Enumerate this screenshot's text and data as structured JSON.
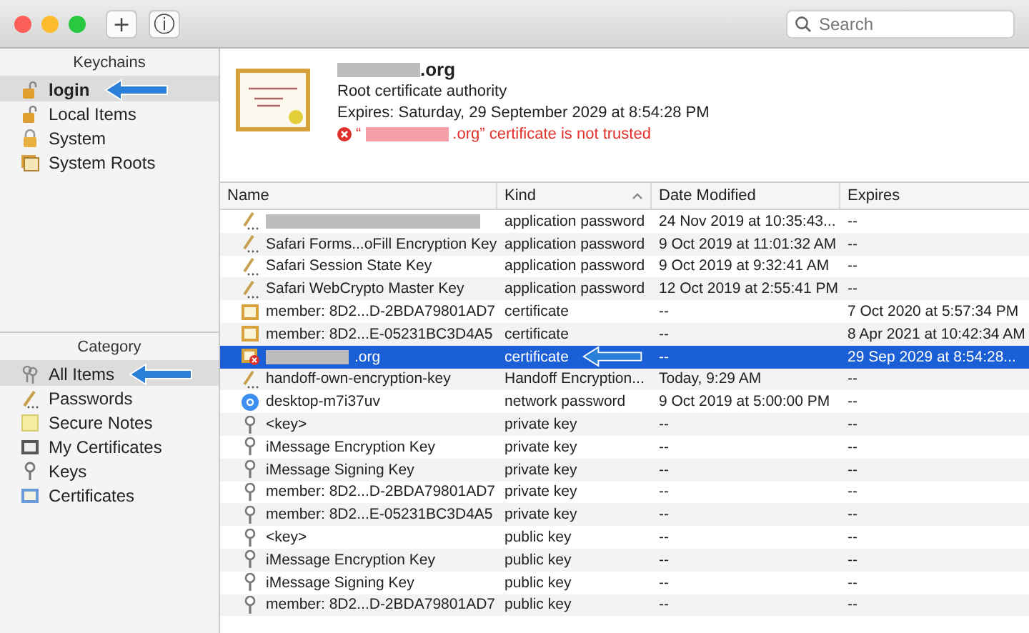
{
  "toolbar": {
    "buttons": [
      "+",
      "ⓘ"
    ],
    "search": {
      "placeholder": "Search"
    }
  },
  "sidebar": {
    "keychains": {
      "title": "Keychains",
      "items": [
        {
          "label": "login",
          "kind": "unlocked",
          "selected": true
        },
        {
          "label": "Local Items",
          "kind": "unlocked",
          "selected": false
        },
        {
          "label": "System",
          "kind": "locked",
          "selected": false
        },
        {
          "label": "System Roots",
          "kind": "stack",
          "selected": false
        }
      ]
    },
    "category": {
      "title": "Category",
      "items": [
        {
          "label": "All Items",
          "kind": "keys",
          "selected": true
        },
        {
          "label": "Passwords",
          "kind": "pen",
          "selected": false
        },
        {
          "label": "Secure Notes",
          "kind": "note",
          "selected": false
        },
        {
          "label": "My Certificates",
          "kind": "identity",
          "selected": false
        },
        {
          "label": "Keys",
          "kind": "key",
          "selected": false
        },
        {
          "label": "Certificates",
          "kind": "cert",
          "selected": false
        }
      ]
    }
  },
  "details": {
    "name": ".org",
    "name_redacted": true,
    "subtitle": "Root certificate authority",
    "expires": "Expires: Saturday, 29 September 2029 at 8:54:28 PM",
    "warning_open": "“",
    "warning": ".org” certificate is not trusted",
    "warning_redacted": true
  },
  "table": {
    "columns": [
      {
        "label": "Name",
        "sorted": false
      },
      {
        "label": "Kind",
        "sorted": true
      },
      {
        "label": "Date Modified",
        "sorted": false
      },
      {
        "label": "Expires",
        "sorted": false
      }
    ],
    "rows": [
      {
        "kind": "password",
        "redacted": true,
        "item_type": "application password",
        "modified": "24 Nov 2019 at 10:35:43...",
        "expires": "--",
        "selected": false
      },
      {
        "kind": "password",
        "name": "Safari Forms...oFill Encryption Key",
        "item_type": "application password",
        "modified": "9 Oct 2019 at 11:01:32 AM",
        "expires": "--",
        "selected": false
      },
      {
        "kind": "password",
        "name": "Safari Session State Key",
        "item_type": "application password",
        "modified": "9 Oct 2019 at 9:32:41 AM",
        "expires": "--",
        "selected": false
      },
      {
        "kind": "password",
        "name": "Safari WebCrypto Master Key",
        "item_type": "application password",
        "modified": "12 Oct 2019 at 2:55:41 PM",
        "expires": "--",
        "selected": false
      },
      {
        "kind": "certificate",
        "name": "member: 8D2...D-2BDA79801AD7",
        "item_type": "certificate",
        "modified": "--",
        "expires": "7 Oct 2020 at 5:57:34 PM",
        "selected": false
      },
      {
        "kind": "certificate",
        "name": "member: 8D2...E-05231BC3D4A5",
        "item_type": "certificate",
        "modified": "--",
        "expires": "8 Apr 2021 at 10:42:34 AM",
        "selected": false
      },
      {
        "kind": "untrusted",
        "name": ".org",
        "redacted": true,
        "item_type": "certificate",
        "modified": "--",
        "expires": "29 Sep 2029 at 8:54:28...",
        "selected": true
      },
      {
        "kind": "password",
        "name": "handoff-own-encryption-key",
        "item_type": "Handoff Encryption...",
        "modified": "Today, 9:29 AM",
        "expires": "--",
        "selected": false
      },
      {
        "kind": "network",
        "name": "desktop-m7i37uv",
        "item_type": "network password",
        "modified": "9 Oct 2019 at 5:00:00 PM",
        "expires": "--",
        "selected": false
      },
      {
        "kind": "key",
        "name": "<key>",
        "item_type": "private key",
        "modified": "--",
        "expires": "--",
        "selected": false
      },
      {
        "kind": "key",
        "name": "iMessage Encryption Key",
        "item_type": "private key",
        "modified": "--",
        "expires": "--",
        "selected": false
      },
      {
        "kind": "key",
        "name": "iMessage Signing Key",
        "item_type": "private key",
        "modified": "--",
        "expires": "--",
        "selected": false
      },
      {
        "kind": "key",
        "name": "member: 8D2...D-2BDA79801AD7",
        "item_type": "private key",
        "modified": "--",
        "expires": "--",
        "selected": false
      },
      {
        "kind": "key",
        "name": "member: 8D2...E-05231BC3D4A5",
        "item_type": "private key",
        "modified": "--",
        "expires": "--",
        "selected": false
      },
      {
        "kind": "key",
        "name": "<key>",
        "item_type": "public key",
        "modified": "--",
        "expires": "--",
        "selected": false
      },
      {
        "kind": "key",
        "name": "iMessage Encryption Key",
        "item_type": "public key",
        "modified": "--",
        "expires": "--",
        "selected": false
      },
      {
        "kind": "key",
        "name": "iMessage Signing Key",
        "item_type": "public key",
        "modified": "--",
        "expires": "--",
        "selected": false
      },
      {
        "kind": "key",
        "name": "member: 8D2...D-2BDA79801AD7",
        "item_type": "public key",
        "modified": "--",
        "expires": "--",
        "selected": false
      }
    ]
  }
}
